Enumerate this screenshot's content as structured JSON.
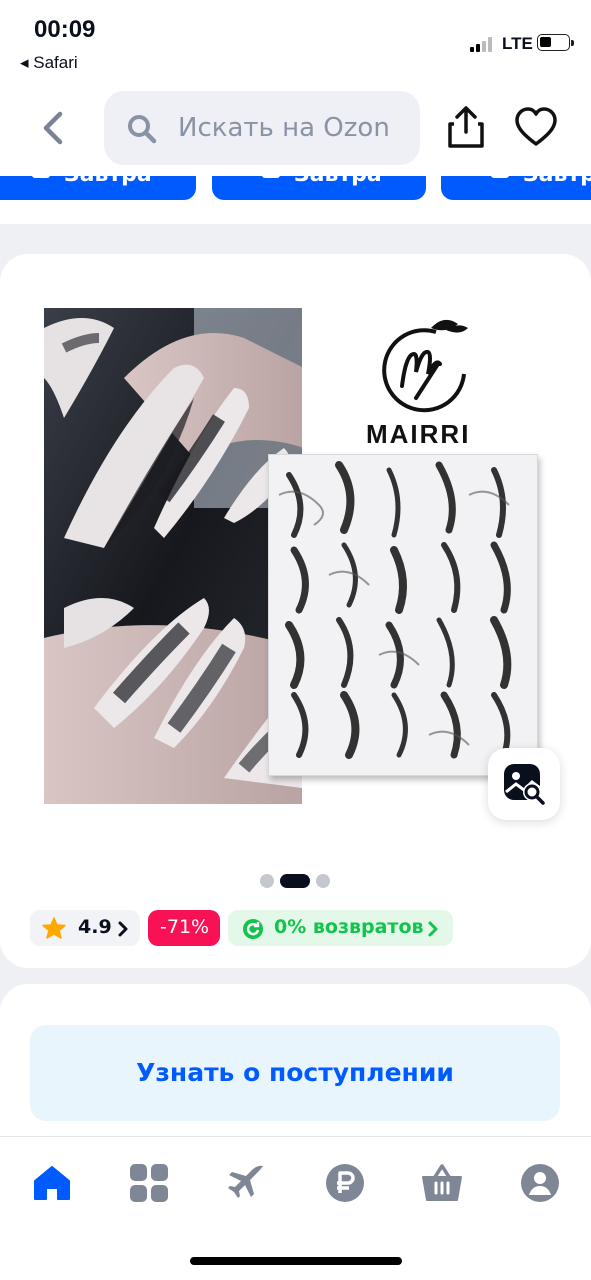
{
  "status_bar": {
    "time": "00:09",
    "back_app": "◂ Safari",
    "network": "LTE"
  },
  "nav": {
    "search_placeholder": "Искать на Ozon"
  },
  "delivery_buttons": [
    "Завтра",
    "Завтра",
    "Завтра"
  ],
  "product": {
    "brand": "MAIRRI",
    "gallery": {
      "total_images": 3,
      "active_index": 1
    },
    "rating": "4.9",
    "discount": "-71%",
    "returns": "0% возвратов"
  },
  "notify": {
    "label": "Узнать о поступлении"
  },
  "tabbar": {
    "items": [
      "home-icon",
      "catalog-icon",
      "travel-icon",
      "finance-icon",
      "cart-icon",
      "profile-icon"
    ],
    "active": "home-icon"
  },
  "colors": {
    "accent": "#005bff",
    "discount": "#f91155",
    "success": "#10c44c",
    "rating_star": "#ffa800"
  }
}
